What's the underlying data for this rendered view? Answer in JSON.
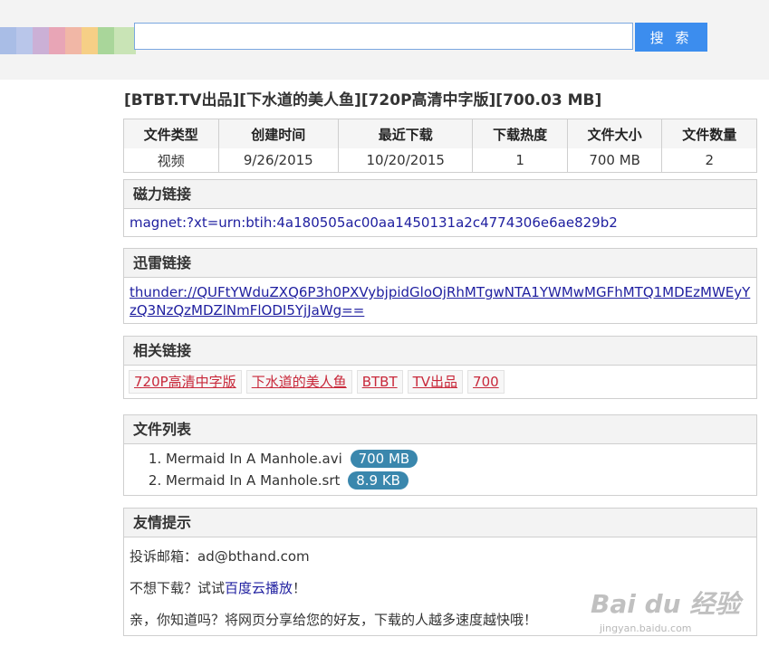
{
  "header": {
    "search_placeholder": "",
    "search_button": "搜 索",
    "logo_colors": [
      "#a9bde6",
      "#b9c6ea",
      "#cbb0d6",
      "#e8a5b6",
      "#f1b7a6",
      "#f6cf86",
      "#a9d69a",
      "#c9e4b6"
    ]
  },
  "page_title": "[BTBT.TV出品][下水道的美人鱼][720P高清中字版][700.03 MB]",
  "info": {
    "headers": [
      "文件类型",
      "创建时间",
      "最近下载",
      "下载热度",
      "文件大小",
      "文件数量"
    ],
    "values": [
      "视频",
      "9/26/2015",
      "10/20/2015",
      "1",
      "700 MB",
      "2"
    ]
  },
  "magnet": {
    "title": "磁力链接",
    "link": "magnet:?xt=urn:btih:4a180505ac00aa1450131a2c4774306e6ae829b2"
  },
  "thunder": {
    "title": "迅雷链接",
    "link": "thunder://QUFtYWduZXQ6P3h0PXVybjpidGloOjRhMTgwNTA1YWMwMGFhMTQ1MDEzMWEyYzQ3NzQzMDZlNmFlODI5YjJaWg=="
  },
  "related": {
    "title": "相关链接",
    "tags": [
      "720P高清中字版",
      "下水道的美人鱼",
      "BTBT",
      "TV出品",
      "700"
    ]
  },
  "files": {
    "title": "文件列表",
    "items": [
      {
        "num": "1.",
        "name": "Mermaid In A Manhole.avi",
        "size": "700 MB"
      },
      {
        "num": "2.",
        "name": "Mermaid In A Manhole.srt",
        "size": "8.9 KB"
      }
    ]
  },
  "tips": {
    "title": "友情提示",
    "email_line": "投诉邮箱：ad@bthand.com",
    "download_prefix": "不想下载？试试",
    "download_link": "百度云播放",
    "download_suffix": "！",
    "share_line": "亲，你知道吗？将网页分享给您的好友，下载的人越多速度越快哦！"
  },
  "watermark": {
    "logo": "Bai du 经验",
    "url": "jingyan.baidu.com"
  }
}
